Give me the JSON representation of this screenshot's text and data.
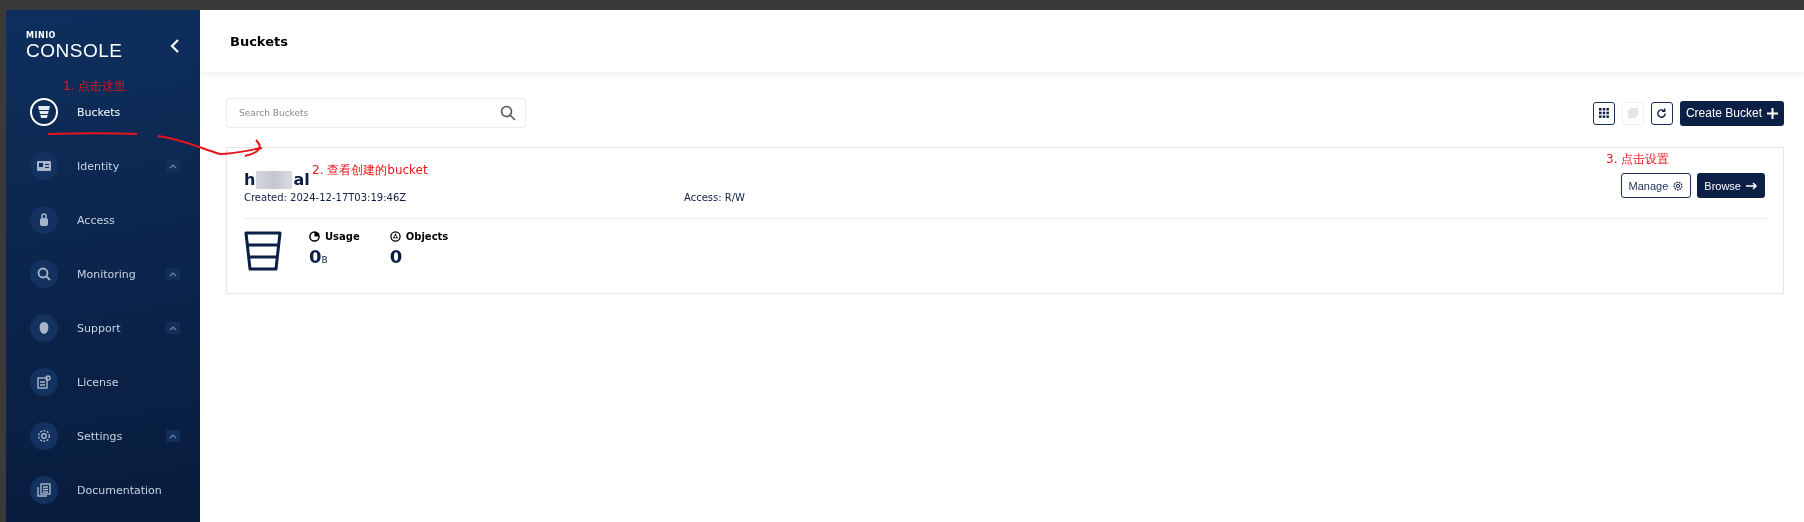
{
  "sidebar": {
    "logo_small": "MINIO",
    "logo": "CONSOLE",
    "items": [
      {
        "label": "Buckets",
        "selected": true,
        "expandable": false
      },
      {
        "label": "Identity",
        "selected": false,
        "expandable": true
      },
      {
        "label": "Access",
        "selected": false,
        "expandable": false
      },
      {
        "label": "Monitoring",
        "selected": false,
        "expandable": true
      },
      {
        "label": "Support",
        "selected": false,
        "expandable": true
      },
      {
        "label": "License",
        "selected": false,
        "expandable": false
      },
      {
        "label": "Settings",
        "selected": false,
        "expandable": true
      },
      {
        "label": "Documentation",
        "selected": false,
        "expandable": false
      }
    ]
  },
  "header": {
    "title": "Buckets"
  },
  "search": {
    "placeholder": "Search Buckets"
  },
  "toolbar": {
    "create_button": "Create Bucket"
  },
  "bucket": {
    "name_start": "h",
    "name_end": "al",
    "created": "Created: 2024-12-17T03:19:46Z",
    "access": "Access: R/W",
    "manage_button": "Manage",
    "browse_button": "Browse",
    "usage_label": "Usage",
    "usage_value": "0",
    "usage_unit": "B",
    "objects_label": "Objects",
    "objects_value": "0"
  },
  "annotations": [
    {
      "text": "1. 点击这里"
    },
    {
      "text": "2. 查看创建的bucket"
    },
    {
      "text": "3. 点击设置"
    }
  ]
}
